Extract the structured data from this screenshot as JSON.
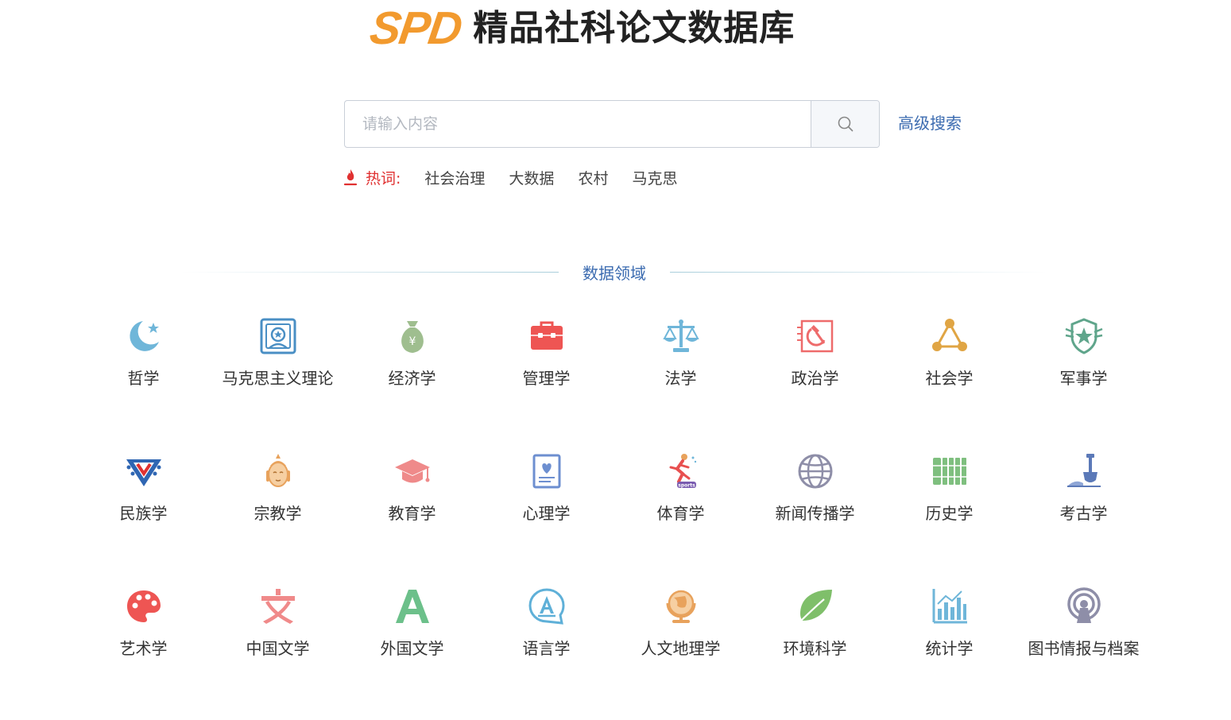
{
  "header": {
    "logo_mark": "SPD",
    "title": "精品社科论文数据库"
  },
  "search": {
    "placeholder": "请输入内容",
    "value": "",
    "button_icon": "search-icon",
    "advanced_label": "高级搜索"
  },
  "hot": {
    "label": "热词:",
    "icon": "flame-icon",
    "words": [
      "社会治理",
      "大数据",
      "农村",
      "马克思"
    ]
  },
  "section": {
    "title": "数据领域"
  },
  "categories": [
    {
      "label": "哲学",
      "icon": "moon-star-icon",
      "color": "#6fb6d9"
    },
    {
      "label": "马克思主义理论",
      "icon": "portrait-frame-icon",
      "color": "#4a8fc4"
    },
    {
      "label": "经济学",
      "icon": "money-bag-icon",
      "color": "#9fbe8f"
    },
    {
      "label": "管理学",
      "icon": "briefcase-icon",
      "color": "#ee5553"
    },
    {
      "label": "法学",
      "icon": "scales-icon",
      "color": "#6fb6d9"
    },
    {
      "label": "政治学",
      "icon": "hammer-sickle-icon",
      "color": "#ee6b6b"
    },
    {
      "label": "社会学",
      "icon": "network-triangle-icon",
      "color": "#e0a544"
    },
    {
      "label": "军事学",
      "icon": "military-badge-icon",
      "color": "#5fa58b"
    },
    {
      "label": "民族学",
      "icon": "ethnic-collar-icon",
      "color": "#2f66b3"
    },
    {
      "label": "宗教学",
      "icon": "buddha-icon",
      "color": "#e8a25c"
    },
    {
      "label": "教育学",
      "icon": "graduation-cap-icon",
      "color": "#ef8a8a"
    },
    {
      "label": "心理学",
      "icon": "heart-document-icon",
      "color": "#6d8fd0"
    },
    {
      "label": "体育学",
      "icon": "runner-icon",
      "color": "#e85050"
    },
    {
      "label": "新闻传播学",
      "icon": "globe-icon",
      "color": "#8e8ea8"
    },
    {
      "label": "历史学",
      "icon": "bamboo-scroll-icon",
      "color": "#7fbf7f"
    },
    {
      "label": "考古学",
      "icon": "shovel-icon",
      "color": "#5b79b8"
    },
    {
      "label": "艺术学",
      "icon": "palette-icon",
      "color": "#ee5553"
    },
    {
      "label": "中国文学",
      "icon": "wen-character-icon",
      "color": "#f08a8a"
    },
    {
      "label": "外国文学",
      "icon": "letter-a-icon",
      "color": "#6cc08a"
    },
    {
      "label": "语言学",
      "icon": "speech-a-icon",
      "color": "#5fb0d8"
    },
    {
      "label": "人文地理学",
      "icon": "globe-stand-icon",
      "color": "#e8a25c"
    },
    {
      "label": "环境科学",
      "icon": "leaf-icon",
      "color": "#7fbf6a"
    },
    {
      "label": "统计学",
      "icon": "bar-chart-icon",
      "color": "#6fb6d9"
    },
    {
      "label": "图书情报与档案",
      "icon": "signal-tower-icon",
      "color": "#8e8ea8"
    }
  ]
}
